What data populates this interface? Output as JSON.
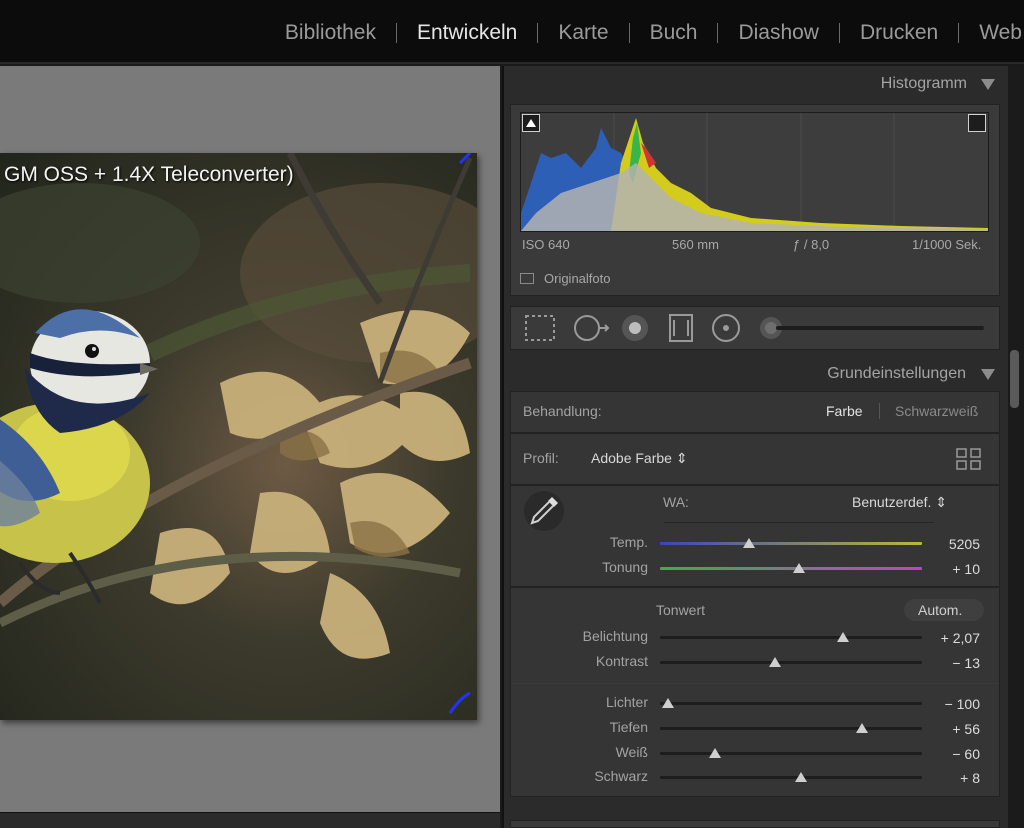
{
  "modules": [
    "Bibliothek",
    "Entwickeln",
    "Karte",
    "Buch",
    "Diashow",
    "Drucken",
    "Web"
  ],
  "active_module": "Entwickeln",
  "photo": {
    "caption": "GM OSS + 1.4X Teleconverter)"
  },
  "histogram": {
    "title": "Histogramm",
    "iso": "ISO 640",
    "focal": "560 mm",
    "aperture": "ƒ / 8,0",
    "shutter": "1/1000 Sek.",
    "original_label": "Originalfoto"
  },
  "basic": {
    "title": "Grundeinstellungen",
    "treatment_label": "Behandlung:",
    "treatment_color": "Farbe",
    "treatment_bw": "Schwarzweiß",
    "profile_label": "Profil:",
    "profile_value": "Adobe Farbe ⇕",
    "wb_label": "WA:",
    "wb_value": "Benutzerdef. ⇕",
    "tone_label": "Tonwert",
    "auto_label": "Autom.",
    "sliders": {
      "temp": {
        "label": "Temp.",
        "value": "5205",
        "position": 0.34
      },
      "tint": {
        "label": "Tonung",
        "value": "+ 10",
        "position": 0.53
      },
      "exposure": {
        "label": "Belichtung",
        "value": "+ 2,07",
        "position": 0.7
      },
      "contrast": {
        "label": "Kontrast",
        "value": "− 13",
        "position": 0.44
      },
      "highlights": {
        "label": "Lichter",
        "value": "− 100",
        "position": 0.03
      },
      "shadows": {
        "label": "Tiefen",
        "value": "+ 56",
        "position": 0.77
      },
      "whites": {
        "label": "Weiß",
        "value": "− 60",
        "position": 0.21
      },
      "blacks": {
        "label": "Schwarz",
        "value": "+ 8",
        "position": 0.54
      }
    }
  },
  "colors": {
    "accent": "#e6e6e6",
    "panel": "#353535",
    "viewer": "#7a7a7a"
  }
}
